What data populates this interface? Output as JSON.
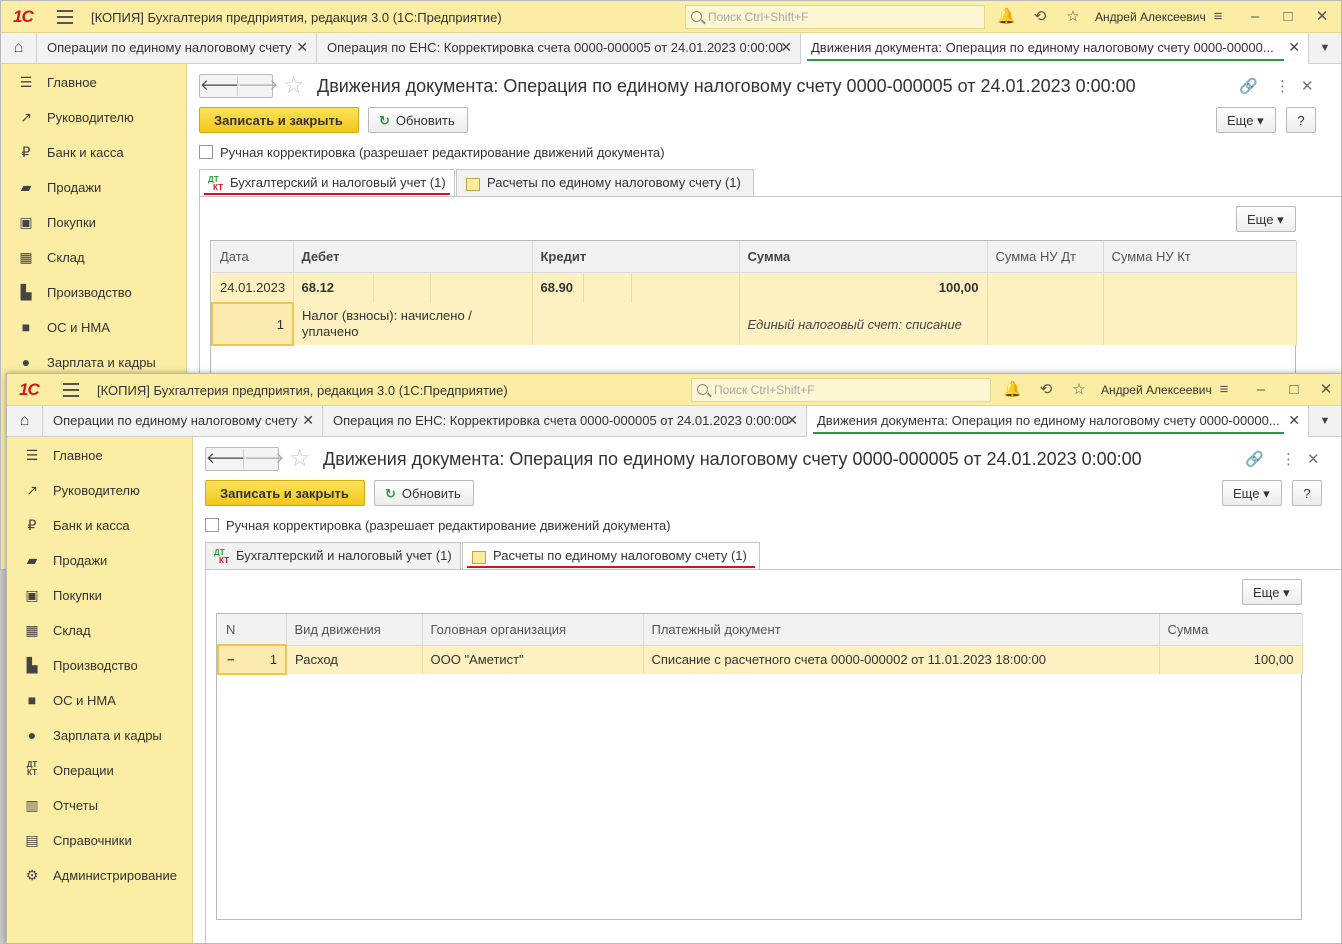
{
  "app": {
    "title": "[КОПИЯ] Бухгалтерия предприятия, редакция 3.0  (1С:Предприятие)",
    "logo": "1С",
    "search_placeholder": "Поиск Ctrl+Shift+F",
    "user": "Андрей Алексеевич"
  },
  "open_tabs": [
    {
      "label": "Операции по единому налоговому счету"
    },
    {
      "label": "Операция по ЕНС: Корректировка счета 0000-000005 от 24.01.2023 0:00:00"
    },
    {
      "label": "Движения документа: Операция по единому налоговому счету 0000-00000..."
    }
  ],
  "sidebar": {
    "items": [
      {
        "label": "Главное",
        "icon": "menu-icon"
      },
      {
        "label": "Руководителю",
        "icon": "trend-icon"
      },
      {
        "label": "Банк и касса",
        "icon": "ruble-icon"
      },
      {
        "label": "Продажи",
        "icon": "bag-icon"
      },
      {
        "label": "Покупки",
        "icon": "basket-icon"
      },
      {
        "label": "Склад",
        "icon": "warehouse-icon"
      },
      {
        "label": "Производство",
        "icon": "factory-icon"
      },
      {
        "label": "ОС и НМА",
        "icon": "truck-icon"
      },
      {
        "label": "Зарплата и кадры",
        "icon": "person-icon"
      },
      {
        "label": "Операции",
        "icon": "dt-kt-icon"
      },
      {
        "label": "Отчеты",
        "icon": "bar-chart-icon"
      },
      {
        "label": "Справочники",
        "icon": "book-icon"
      },
      {
        "label": "Администрирование",
        "icon": "gear-icon"
      }
    ]
  },
  "document": {
    "title": "Движения документа: Операция по единому налоговому счету 0000-000005 от 24.01.2023 0:00:00",
    "save_close": "Записать и закрыть",
    "refresh": "Обновить",
    "more": "Еще",
    "help": "?",
    "manual_correction": "Ручная корректировка (разрешает редактирование движений документа)",
    "form_tabs": [
      {
        "label": "Бухгалтерский и налоговый учет (1)"
      },
      {
        "label": "Расчеты по единому налоговому счету (1)"
      }
    ]
  },
  "accounting_table": {
    "columns": [
      "Дата",
      "Дебет",
      "Кредит",
      "Сумма",
      "Сумма НУ Дт",
      "Сумма НУ Кт"
    ],
    "row": {
      "date": "24.01.2023",
      "line_no": "1",
      "debit": "68.12",
      "debit_subconto": "Налог (взносы): начислено / уплачено",
      "credit": "68.90",
      "amount": "100,00",
      "content": "Единый налоговый счет: списание"
    }
  },
  "ens_table": {
    "columns": [
      "N",
      "Вид движения",
      "Головная организация",
      "Платежный документ",
      "Сумма"
    ],
    "rows": [
      {
        "n": "1",
        "sign": "−",
        "movement": "Расход",
        "org": "ООО \"Аметист\"",
        "doc": "Списание с расчетного счета 0000-000002 от 11.01.2023 18:00:00",
        "amount": "100,00"
      }
    ]
  },
  "colors": {
    "title_bar": "#fbeda4",
    "accent_green": "#2a9b3f",
    "accent_red": "#d4141b",
    "row_highlight": "#fdf1c2"
  }
}
